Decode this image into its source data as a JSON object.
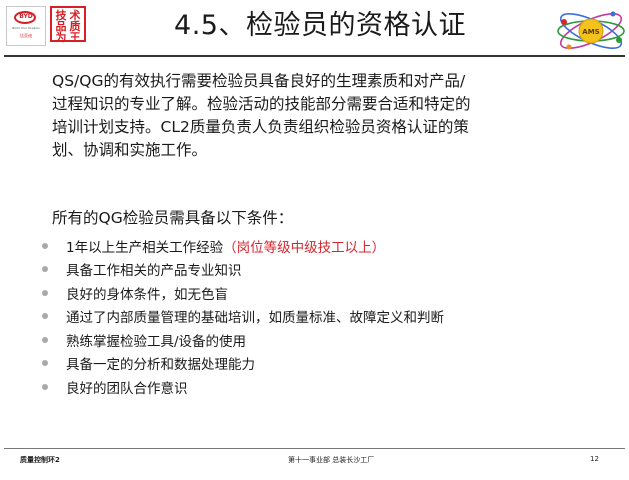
{
  "header": {
    "title": "4.5、检验员的资格认证",
    "logo_text": "BYD",
    "seal_chars": [
      "技",
      "术",
      "品",
      "质",
      "为",
      "王"
    ],
    "badge_text": "AMS"
  },
  "intro": {
    "paragraph": "QS/QG的有效执行需要检验员具备良好的生理素质和对产品/\n过程知识的专业了解。检验活动的技能部分需要合适和特定的\n培训计划支持。CL2质量负责人负责组织检验员资格认证的策\n划、协调和实施工作。"
  },
  "requirements": {
    "heading": "所有的QG检验员需具备以下条件：",
    "items": [
      {
        "text": "1年以上生产相关工作经验",
        "note": "（岗位等级中级技工以上）"
      },
      {
        "text": "具备工作相关的产品专业知识"
      },
      {
        "text": "良好的身体条件，如无色盲"
      },
      {
        "text": "通过了内部质量管理的基础培训，如质量标准、故障定义和判断"
      },
      {
        "text": "熟练掌握检验工具/设备的使用"
      },
      {
        "text": "具备一定的分析和数据处理能力"
      },
      {
        "text": "良好的团队合作意识"
      }
    ]
  },
  "footer": {
    "left": "质量控制环2",
    "center": "第十一事业部 总装长沙工厂",
    "page_number": "12"
  },
  "colors": {
    "accent_red": "#d8262e",
    "bullet_gray": "#a9a9a9",
    "rule": "#333333"
  }
}
